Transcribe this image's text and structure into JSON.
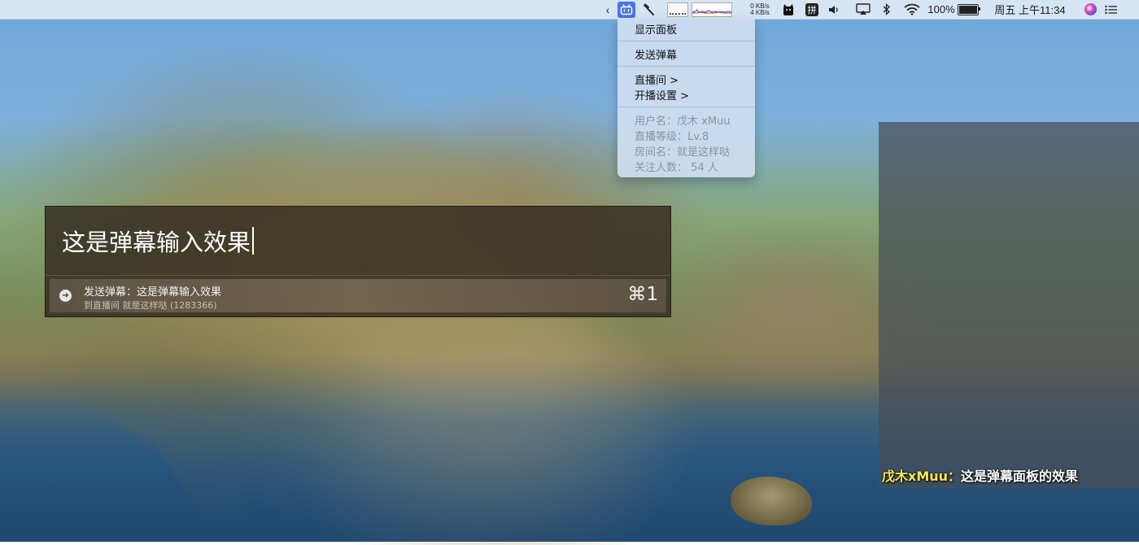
{
  "menubar": {
    "chevron": "‹",
    "net_up": "0 KB/s",
    "net_down": "4 KB/s",
    "ime_label": "拼",
    "battery_percent": "100%",
    "battery_level": 1.0,
    "clock": "周五 上午11:34",
    "icons": [
      "chevron-left-icon",
      "bilibili-icon",
      "hammer-icon",
      "cpu-graph-icon",
      "network-graph-icon",
      "cat-icon",
      "ime-icon",
      "volume-icon",
      "airplay-icon",
      "bluetooth-icon",
      "wifi-icon",
      "battery-icon",
      "siri-icon",
      "notification-center-icon"
    ]
  },
  "dropdown": {
    "items": [
      "显示面板",
      "发送弹幕",
      "直播间 >",
      "开播设置 >"
    ],
    "info": [
      "用户名：戊木 xMuu",
      "直播等级：Lv.8",
      "房间名：就是这样哒",
      "关注人数： 54 人"
    ]
  },
  "input_panel": {
    "text": "这是弹幕输入效果",
    "result_title": "发送弹幕：这是弹幕输入效果",
    "result_subtitle": "到直播间 就是这样哒 (1283366)",
    "shortcut": "⌘1"
  },
  "danmaku_panel": {
    "user": "戊木xMuu",
    "separator": "：",
    "message": "这是弹幕面板的效果",
    "user_color": "#ffe84a"
  }
}
